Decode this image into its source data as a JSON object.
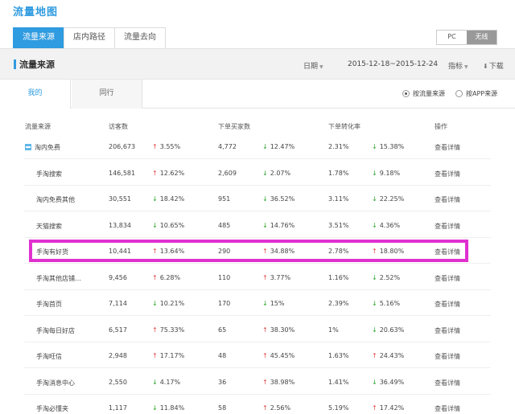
{
  "page_title": "流量地图",
  "main_tabs": [
    {
      "label": "流量来源",
      "active": true
    },
    {
      "label": "店内路径",
      "active": false
    },
    {
      "label": "流量去向",
      "active": false
    }
  ],
  "device_switch": {
    "pc": "PC",
    "wireless": "无线",
    "active": "wireless"
  },
  "section": {
    "title": "流量来源",
    "date_label": "日期",
    "date_range": "2015-12-18~2015-12-24",
    "metrics_label": "指标",
    "download_label": "下载"
  },
  "sub_tabs": [
    {
      "label": "我的",
      "active": true
    },
    {
      "label": "同行",
      "active": false
    }
  ],
  "radios": [
    {
      "label": "按流量来源",
      "checked": true
    },
    {
      "label": "按APP来源",
      "checked": false
    }
  ],
  "table": {
    "headers": [
      "流量来源",
      "访客数",
      "下单买家数",
      "下单转化率",
      "操作"
    ],
    "rows": [
      {
        "source": "淘内免费",
        "visitors": "206,673",
        "v_trend": "up",
        "v_change": "3.55%",
        "buyers": "4,772",
        "b_trend": "down",
        "b_change": "12.47%",
        "rate": "2.31%",
        "r_trend": "down",
        "r_change": "15.38%",
        "action": "查看详情",
        "expandable": true
      },
      {
        "source": "手淘搜索",
        "visitors": "146,581",
        "v_trend": "up",
        "v_change": "12.62%",
        "buyers": "2,609",
        "b_trend": "down",
        "b_change": "2.07%",
        "rate": "1.78%",
        "r_trend": "down",
        "r_change": "9.18%",
        "action": "查看详情"
      },
      {
        "source": "淘内免费其他",
        "visitors": "30,551",
        "v_trend": "down",
        "v_change": "18.42%",
        "buyers": "951",
        "b_trend": "down",
        "b_change": "36.52%",
        "rate": "3.11%",
        "r_trend": "down",
        "r_change": "22.25%",
        "action": "查看详情"
      },
      {
        "source": "天猫搜索",
        "visitors": "13,834",
        "v_trend": "down",
        "v_change": "10.65%",
        "buyers": "485",
        "b_trend": "down",
        "b_change": "14.76%",
        "rate": "3.51%",
        "r_trend": "down",
        "r_change": "4.36%",
        "action": "查看详情"
      },
      {
        "source": "手淘有好货",
        "visitors": "10,441",
        "v_trend": "up",
        "v_change": "13.64%",
        "buyers": "290",
        "b_trend": "up",
        "b_change": "34.88%",
        "rate": "2.78%",
        "r_trend": "up",
        "r_change": "18.80%",
        "action": "查看详情",
        "highlighted": true
      },
      {
        "source": "手淘其他店铺…",
        "visitors": "9,456",
        "v_trend": "up",
        "v_change": "6.28%",
        "buyers": "110",
        "b_trend": "up",
        "b_change": "3.77%",
        "rate": "1.16%",
        "r_trend": "down",
        "r_change": "2.52%",
        "action": "查看详情"
      },
      {
        "source": "手淘首页",
        "visitors": "7,114",
        "v_trend": "down",
        "v_change": "10.21%",
        "buyers": "170",
        "b_trend": "down",
        "b_change": "15%",
        "rate": "2.39%",
        "r_trend": "down",
        "r_change": "5.16%",
        "action": "查看详情"
      },
      {
        "source": "手淘每日好店",
        "visitors": "6,517",
        "v_trend": "up",
        "v_change": "75.33%",
        "buyers": "65",
        "b_trend": "up",
        "b_change": "38.30%",
        "rate": "1%",
        "r_trend": "down",
        "r_change": "20.63%",
        "action": "查看详情"
      },
      {
        "source": "手淘旺信",
        "visitors": "2,948",
        "v_trend": "up",
        "v_change": "17.17%",
        "buyers": "48",
        "b_trend": "up",
        "b_change": "45.45%",
        "rate": "1.63%",
        "r_trend": "up",
        "r_change": "24.43%",
        "action": "查看详情"
      },
      {
        "source": "手淘消息中心",
        "visitors": "2,550",
        "v_trend": "down",
        "v_change": "4.17%",
        "buyers": "36",
        "b_trend": "up",
        "b_change": "38.98%",
        "rate": "1.41%",
        "r_trend": "down",
        "r_change": "36.49%",
        "action": "查看详情"
      },
      {
        "source": "手淘必懂夹",
        "visitors": "1,117",
        "v_trend": "down",
        "v_change": "11.84%",
        "buyers": "58",
        "b_trend": "up",
        "b_change": "2.56%",
        "rate": "5.19%",
        "r_trend": "up",
        "r_change": "17.42%",
        "action": "查看详情"
      }
    ]
  },
  "colors": {
    "accent": "#2f9be0",
    "up": "#e04848",
    "down": "#2aa52a",
    "highlight": "#e030d0"
  },
  "icons": {
    "up_arrow": "↑",
    "down_arrow": "↓",
    "download": "⬇"
  }
}
